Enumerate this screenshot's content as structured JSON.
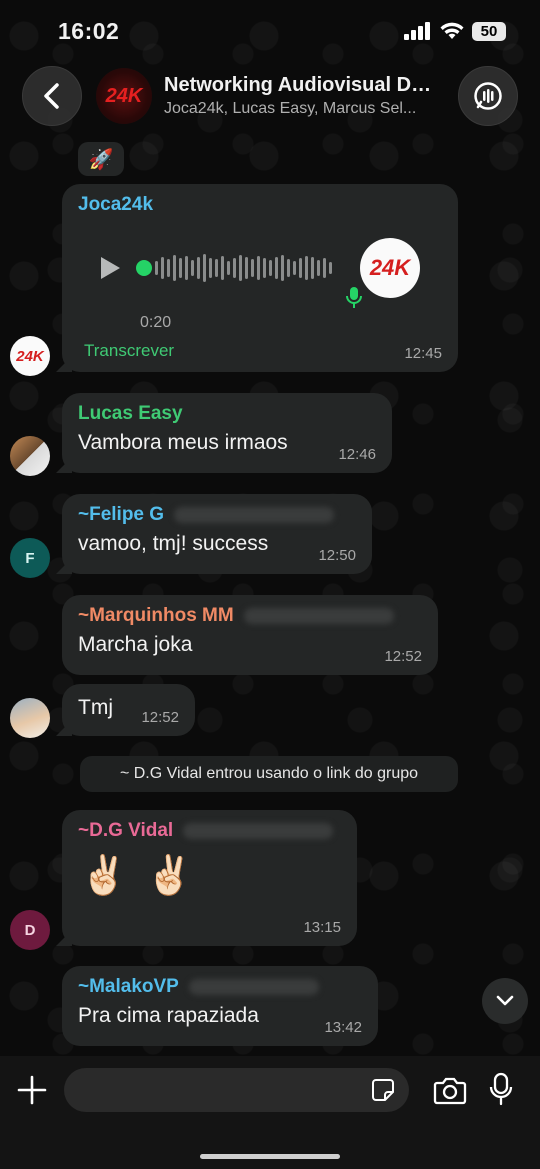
{
  "status_bar": {
    "time": "16:02",
    "battery": "50"
  },
  "header": {
    "title": "Networking Audiovisual Doi...",
    "members": "Joca24k, Lucas Easy, Marcus Sel...",
    "avatar_text": "24K"
  },
  "messages": [
    {
      "sender": "Joca24k",
      "sender_color": "#53bdeb",
      "type": "audio",
      "duration": "0:20",
      "transcribe_label": "Transcrever",
      "time": "12:45",
      "avatar_text": "24K"
    },
    {
      "sender": "Lucas Easy",
      "sender_color": "#3fca74",
      "text": "Vambora meus irmaos",
      "time": "12:46"
    },
    {
      "sender": "~Felipe G",
      "sender_color": "#53bdeb",
      "text": "vamoo, tmj! success",
      "time": "12:50",
      "avatar_text": "F"
    },
    {
      "sender": "~Marquinhos MM",
      "sender_color": "#f08a65",
      "text": "Marcha joka",
      "time": "12:52"
    },
    {
      "text": "Tmj",
      "time": "12:52"
    },
    {
      "sender": "~D.G Vidal",
      "sender_color": "#e96a96",
      "text": "✌🏻 ✌🏻",
      "time": "13:15",
      "avatar_text": "D"
    },
    {
      "sender": "~MalakoVP",
      "sender_color": "#53bdeb",
      "text": "Pra cima rapaziada",
      "time": "13:42"
    }
  ],
  "system_message": "~ D.G Vidal entrou usando o link do grupo",
  "top_reaction": "🚀",
  "composer": {
    "placeholder": ""
  },
  "colors": {
    "background": "#0b0b0b",
    "bubble": "#242626",
    "time_text": "#a9a9a9",
    "accent_green": "#25d366"
  },
  "icons": [
    "back-icon",
    "call-icon",
    "play-icon",
    "mic-icon",
    "chevron-down-icon",
    "plus-icon",
    "sticker-icon",
    "camera-icon",
    "microphone-icon",
    "signal-icon",
    "wifi-icon"
  ]
}
